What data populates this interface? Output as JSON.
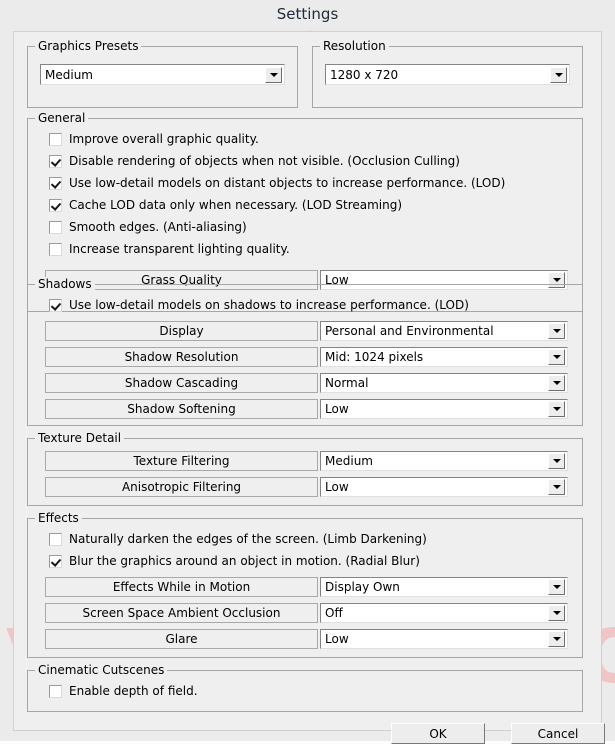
{
  "window": {
    "title": "Settings"
  },
  "watermark": {
    "text": "VMODTECH.COM",
    "color": "#f3b7b7"
  },
  "presets": {
    "legend": "Graphics Presets",
    "value": "Medium"
  },
  "resolution": {
    "legend": "Resolution",
    "value": "1280 x 720"
  },
  "general": {
    "legend": "General",
    "checkboxes": [
      {
        "label": "Improve overall graphic quality.",
        "checked": false
      },
      {
        "label": "Disable rendering of objects when not visible. (Occlusion Culling)",
        "checked": true
      },
      {
        "label": "Use low-detail models on distant objects to increase performance. (LOD)",
        "checked": true
      },
      {
        "label": "Cache LOD data only when necessary. (LOD Streaming)",
        "checked": true
      },
      {
        "label": "Smooth edges. (Anti-aliasing)",
        "checked": false
      },
      {
        "label": "Increase transparent lighting quality.",
        "checked": false
      }
    ],
    "rows": [
      {
        "label": "Grass Quality",
        "value": "Low"
      }
    ]
  },
  "shadows": {
    "legend": "Shadows",
    "checkboxes": [
      {
        "label": "Use low-detail models on shadows to increase performance. (LOD)",
        "checked": true
      }
    ],
    "rows": [
      {
        "label": "Display",
        "value": "Personal and Environmental"
      },
      {
        "label": "Shadow Resolution",
        "value": "Mid: 1024 pixels"
      },
      {
        "label": "Shadow Cascading",
        "value": "Normal"
      },
      {
        "label": "Shadow Softening",
        "value": "Low"
      }
    ]
  },
  "texture_detail": {
    "legend": "Texture Detail",
    "rows": [
      {
        "label": "Texture Filtering",
        "value": "Medium"
      },
      {
        "label": "Anisotropic Filtering",
        "value": "Low"
      }
    ]
  },
  "effects": {
    "legend": "Effects",
    "checkboxes": [
      {
        "label": "Naturally darken the edges of the screen. (Limb Darkening)",
        "checked": false
      },
      {
        "label": "Blur the graphics around an object in motion. (Radial Blur)",
        "checked": true
      }
    ],
    "rows": [
      {
        "label": "Effects While in Motion",
        "value": "Display Own"
      },
      {
        "label": "Screen Space Ambient Occlusion",
        "value": "Off"
      },
      {
        "label": "Glare",
        "value": "Low"
      }
    ]
  },
  "cinematic": {
    "legend": "Cinematic Cutscenes",
    "checkboxes": [
      {
        "label": "Enable depth of field.",
        "checked": false
      }
    ]
  },
  "buttons": {
    "ok": "OK",
    "cancel": "Cancel"
  }
}
